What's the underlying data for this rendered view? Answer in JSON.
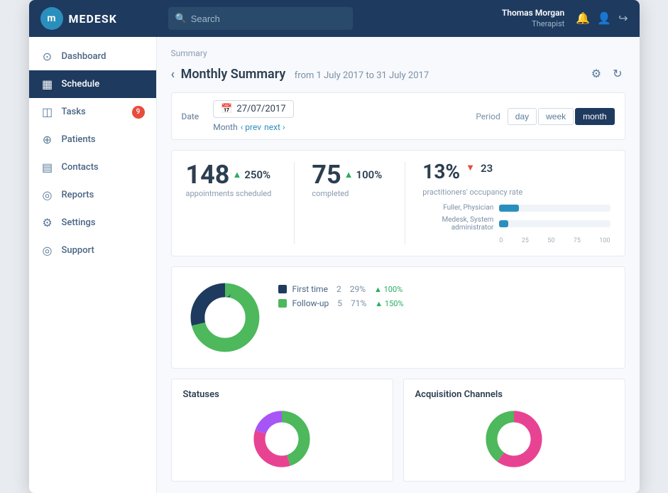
{
  "topbar": {
    "logo_text": "MEDESK",
    "search_placeholder": "Search",
    "user_name": "Thomas Morgan",
    "user_role": "Therapist"
  },
  "sidebar": {
    "items": [
      {
        "id": "dashboard",
        "label": "Dashboard",
        "icon": "⊙",
        "active": false
      },
      {
        "id": "schedule",
        "label": "Schedule",
        "icon": "▦",
        "active": true
      },
      {
        "id": "tasks",
        "label": "Tasks",
        "icon": "◫",
        "active": false,
        "badge": "9"
      },
      {
        "id": "patients",
        "label": "Patients",
        "icon": "⊕",
        "active": false
      },
      {
        "id": "contacts",
        "label": "Contacts",
        "icon": "▤",
        "active": false
      },
      {
        "id": "reports",
        "label": "Reports",
        "icon": "◎",
        "active": false
      },
      {
        "id": "settings",
        "label": "Settings",
        "icon": "⚙",
        "active": false
      },
      {
        "id": "support",
        "label": "Support",
        "icon": "◎",
        "active": false
      }
    ]
  },
  "breadcrumb": "Summary",
  "page_title": "Monthly Summary",
  "date_range_text": "from 1 July 2017 to 31 July 2017",
  "nav_back": "‹",
  "filter": {
    "date_label": "Date",
    "date_value": "27/07/2017",
    "month_nav": "Month",
    "prev_label": "‹ prev",
    "next_label": "next ›",
    "period_label": "Period",
    "period_options": [
      "day",
      "week",
      "month"
    ],
    "period_active": "month"
  },
  "stats": {
    "appointments": {
      "number": "148",
      "arrow": "up",
      "pct": "250%",
      "label": "appointments scheduled"
    },
    "completed": {
      "number": "75",
      "arrow": "up",
      "pct": "100%",
      "label": "completed"
    },
    "occupancy": {
      "number": "13%",
      "arrow": "down",
      "value": "23",
      "label": "practitioners' occupancy rate"
    }
  },
  "bar_chart": {
    "rows": [
      {
        "name": "Fuller, Physician",
        "pct": 18
      },
      {
        "name": "Medesk, System administrator",
        "pct": 8
      }
    ],
    "axis": [
      "0",
      "25",
      "50",
      "75",
      "100"
    ]
  },
  "donut_main": {
    "segments": [
      {
        "color": "#4db85c",
        "pct": 71,
        "offset": 0
      },
      {
        "color": "#1e3a5f",
        "pct": 29,
        "offset": 71
      }
    ]
  },
  "legend": {
    "items": [
      {
        "color": "#1e3a5f",
        "label": "First time",
        "count": "2",
        "pct": "29%",
        "change": "▲ 100%",
        "change_color": "#27ae60"
      },
      {
        "color": "#4db85c",
        "label": "Follow-up",
        "count": "5",
        "pct": "71%",
        "change": "▲ 150%",
        "change_color": "#27ae60"
      }
    ]
  },
  "bottom_charts": {
    "statuses_title": "Statuses",
    "channels_title": "Acquisition Channels"
  },
  "donut_statuses": {
    "segments": [
      {
        "color": "#4db85c",
        "pct": 45
      },
      {
        "color": "#e84393",
        "pct": 35
      },
      {
        "color": "#a855f7",
        "pct": 20
      }
    ]
  },
  "donut_channels": {
    "segments": [
      {
        "color": "#e84393",
        "pct": 60
      },
      {
        "color": "#4db85c",
        "pct": 40
      }
    ]
  }
}
